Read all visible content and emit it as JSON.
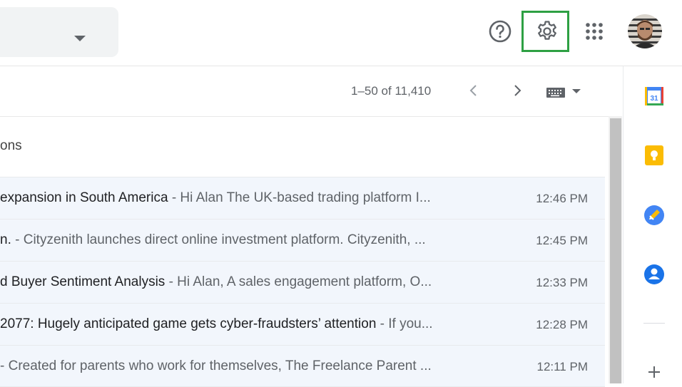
{
  "header": {
    "help_icon": "help-circle-icon",
    "settings_icon": "gear-icon",
    "apps_icon": "apps-grid-icon",
    "avatar_icon": "account-avatar"
  },
  "toolbar": {
    "pagination": "1–50 of 11,410",
    "prev_icon": "chevron-left-icon",
    "next_icon": "chevron-right-icon",
    "input_tools_icon": "keyboard-icon"
  },
  "section": {
    "label": "ons"
  },
  "emails": [
    {
      "subject": "expansion in South America",
      "snippet": " - Hi Alan The UK-based trading platform I...",
      "time": "12:46 PM"
    },
    {
      "subject": "n.",
      "snippet": " - Cityzenith launches direct online investment platform. Cityzenith, ...",
      "time": "12:45 PM"
    },
    {
      "subject": "d Buyer Sentiment Analysis",
      "snippet": " - Hi Alan, A sales engagement platform, O...",
      "time": "12:33 PM"
    },
    {
      "subject": "2077: Hugely anticipated game gets cyber-fraudsters’ attention",
      "snippet": " - If you...",
      "time": "12:28 PM"
    },
    {
      "subject": "",
      "snippet": "- Created for parents who work for themselves, The Freelance Parent ...",
      "time": "12:11 PM"
    }
  ],
  "side_panel": {
    "calendar_label": "31",
    "icons": [
      "calendar-icon",
      "keep-icon",
      "tasks-icon",
      "contacts-icon",
      "add-icon"
    ]
  },
  "colors": {
    "highlight": "#2ea043",
    "row_background": "#f2f6fc",
    "calendar_blue": "#4285f4",
    "keep_yellow": "#fbbc04"
  }
}
